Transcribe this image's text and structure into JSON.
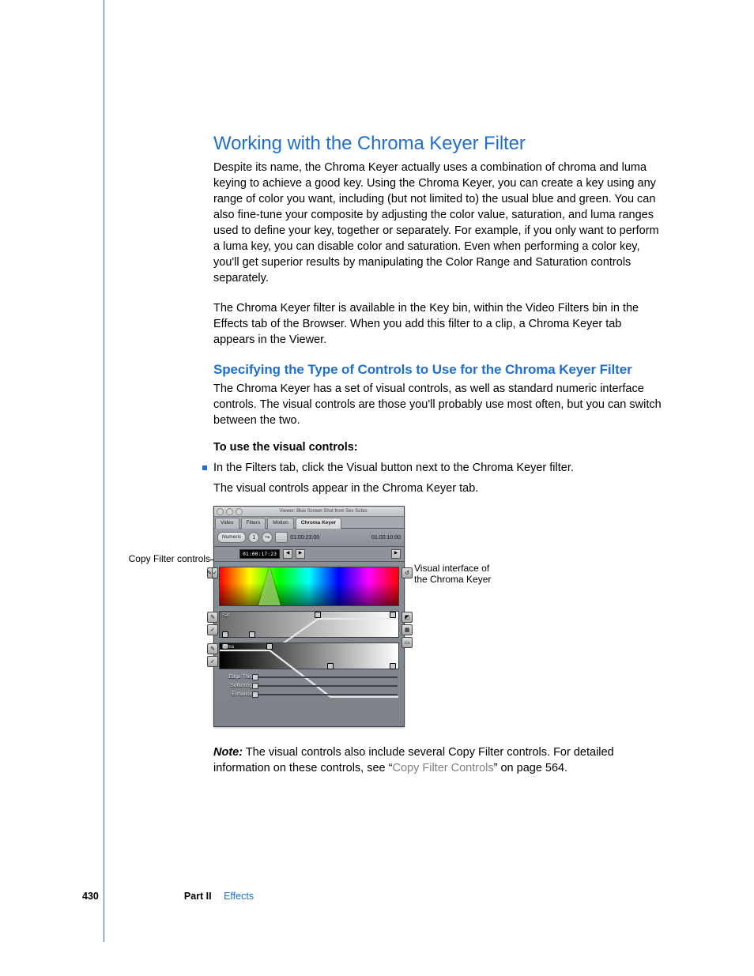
{
  "headings": {
    "h1": "Working with the Chroma Keyer Filter",
    "h2": "Specifying the Type of Controls to Use for the Chroma Keyer Filter"
  },
  "paragraphs": {
    "p1": "Despite its name, the Chroma Keyer actually uses a combination of chroma and luma keying to achieve a good key. Using the Chroma Keyer, you can create a key using any range of color you want, including (but not limited to) the usual blue and green. You can also fine-tune your composite by adjusting the color value, saturation, and luma ranges used to define your key, together or separately. For example, if you only want to perform a luma key, you can disable color and saturation. Even when performing a color key, you'll get superior results by manipulating the Color Range and Saturation controls separately.",
    "p2": "The Chroma Keyer filter is available in the Key bin, within the Video Filters bin in the Effects tab of the Browser. When you add this filter to a clip, a Chroma Keyer tab appears in the Viewer.",
    "p3": "The Chroma Keyer has a set of visual controls, as well as standard numeric interface controls. The visual controls are those you'll probably use most often, but you can switch between the two.",
    "instr_head": "To use the visual controls:",
    "bullet": "In the Filters tab, click the Visual button next to the Chroma Keyer filter.",
    "after_bullet": "The visual controls appear in the Chroma Keyer tab.",
    "note_label": "Note:",
    "note_body_1": "  The visual controls also include several Copy Filter controls. For detailed information on these controls, see “",
    "note_link": "Copy Filter Controls",
    "note_body_2": "” on page 564."
  },
  "callouts": {
    "left": "Copy Filter controls",
    "right_l1": "Visual interface of",
    "right_l2": "the Chroma Keyer"
  },
  "figure": {
    "window_title": "Viewer: Blue Screen Shot from Sex Sofas",
    "tabs": [
      "Video",
      "Filters",
      "Motion",
      "Chroma Keyer"
    ],
    "active_tab_index": 3,
    "numeric_btn": "Numeric",
    "tc_a": "01:00:23:00",
    "tc_b": "01:00:10:00",
    "tc_cur": "01:00:17:23",
    "panel_labels": {
      "sat": "Sat",
      "luma": "Luma"
    },
    "sliders": [
      "Edge Thin",
      "Softening",
      "Enhance"
    ]
  },
  "footer": {
    "page": "430",
    "part": "Part II",
    "section": "Effects"
  }
}
